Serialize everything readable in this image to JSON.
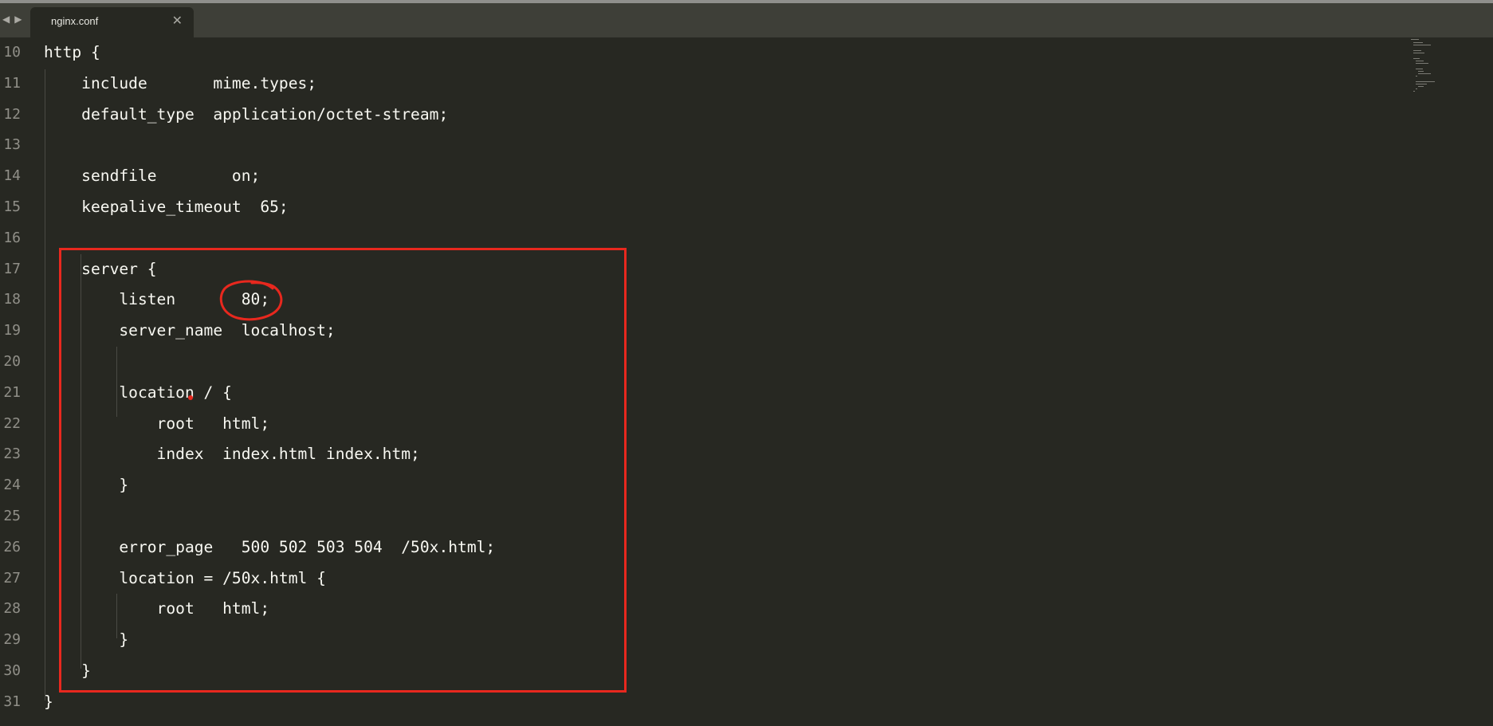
{
  "tabs": [
    {
      "label": "nginx.conf",
      "close": "✕"
    }
  ],
  "nav": {
    "prev": "◀",
    "next": "▶"
  },
  "colors": {
    "background": "#272822",
    "tabbar": "#3e3f38",
    "text": "#f8f8f2",
    "line_number": "#908f88",
    "annotation": "#e8281e"
  },
  "lines": [
    {
      "num": "10",
      "text": "http {"
    },
    {
      "num": "11",
      "text": "    include       mime.types;"
    },
    {
      "num": "12",
      "text": "    default_type  application/octet-stream;"
    },
    {
      "num": "13",
      "text": ""
    },
    {
      "num": "14",
      "text": "    sendfile        on;"
    },
    {
      "num": "15",
      "text": "    keepalive_timeout  65;"
    },
    {
      "num": "16",
      "text": ""
    },
    {
      "num": "17",
      "text": "    server {"
    },
    {
      "num": "18",
      "text": "        listen       80;"
    },
    {
      "num": "19",
      "text": "        server_name  localhost;"
    },
    {
      "num": "20",
      "text": ""
    },
    {
      "num": "21",
      "text": "        location / {"
    },
    {
      "num": "22",
      "text": "            root   html;"
    },
    {
      "num": "23",
      "text": "            index  index.html index.htm;"
    },
    {
      "num": "24",
      "text": "        }"
    },
    {
      "num": "25",
      "text": ""
    },
    {
      "num": "26",
      "text": "        error_page   500 502 503 504  /50x.html;"
    },
    {
      "num": "27",
      "text": "        location = /50x.html {"
    },
    {
      "num": "28",
      "text": "            root   html;"
    },
    {
      "num": "29",
      "text": "        }"
    },
    {
      "num": "30",
      "text": "    }"
    },
    {
      "num": "31",
      "text": "}"
    }
  ]
}
